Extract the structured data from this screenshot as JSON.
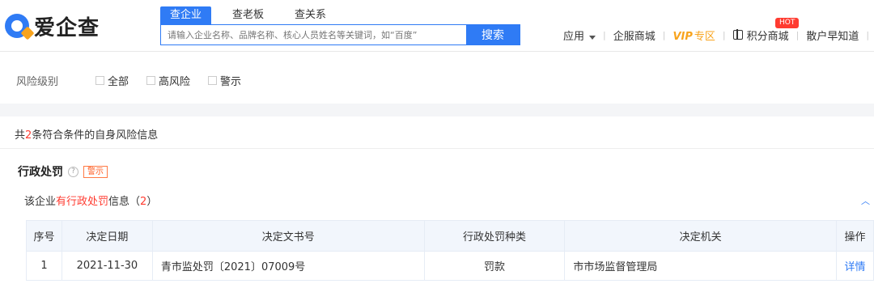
{
  "header": {
    "logo_text": "爱企查",
    "tabs": [
      "查企业",
      "查老板",
      "查关系"
    ],
    "search_placeholder": "请输入企业名称、品牌名称、核心人员姓名等关键词，如“百度”",
    "search_button": "搜索",
    "nav": {
      "app": "应用",
      "service_mall": "企服商城",
      "vip": "VIP",
      "vip_zone": "专区",
      "points_mall": "积分商城",
      "hot_badge": "HOT",
      "investor": "散户早知道"
    }
  },
  "filter": {
    "label": "风险级别",
    "options": [
      "全部",
      "高风险",
      "警示"
    ]
  },
  "summary": {
    "prefix": "共",
    "count": "2",
    "suffix": "条符合条件的自身风险信息"
  },
  "section": {
    "title": "行政处罚",
    "help": "?",
    "tag": "警示",
    "sub_prefix": "该企业",
    "sub_highlight": "有行政处罚",
    "sub_mid": "信息（",
    "sub_count": "2",
    "sub_end": "）"
  },
  "table": {
    "headers": [
      "序号",
      "决定日期",
      "决定文书号",
      "行政处罚种类",
      "决定机关",
      "操作"
    ],
    "rows": [
      {
        "no": "1",
        "date": "2021-11-30",
        "doc": "青市监处罚〔2021〕07009号",
        "type": "罚款",
        "authority": "市市场监督管理局",
        "action": "详情"
      }
    ]
  },
  "colors": {
    "accent": "#2f7bf5",
    "warn": "#ff3b30",
    "vip": "#f8a31c"
  }
}
